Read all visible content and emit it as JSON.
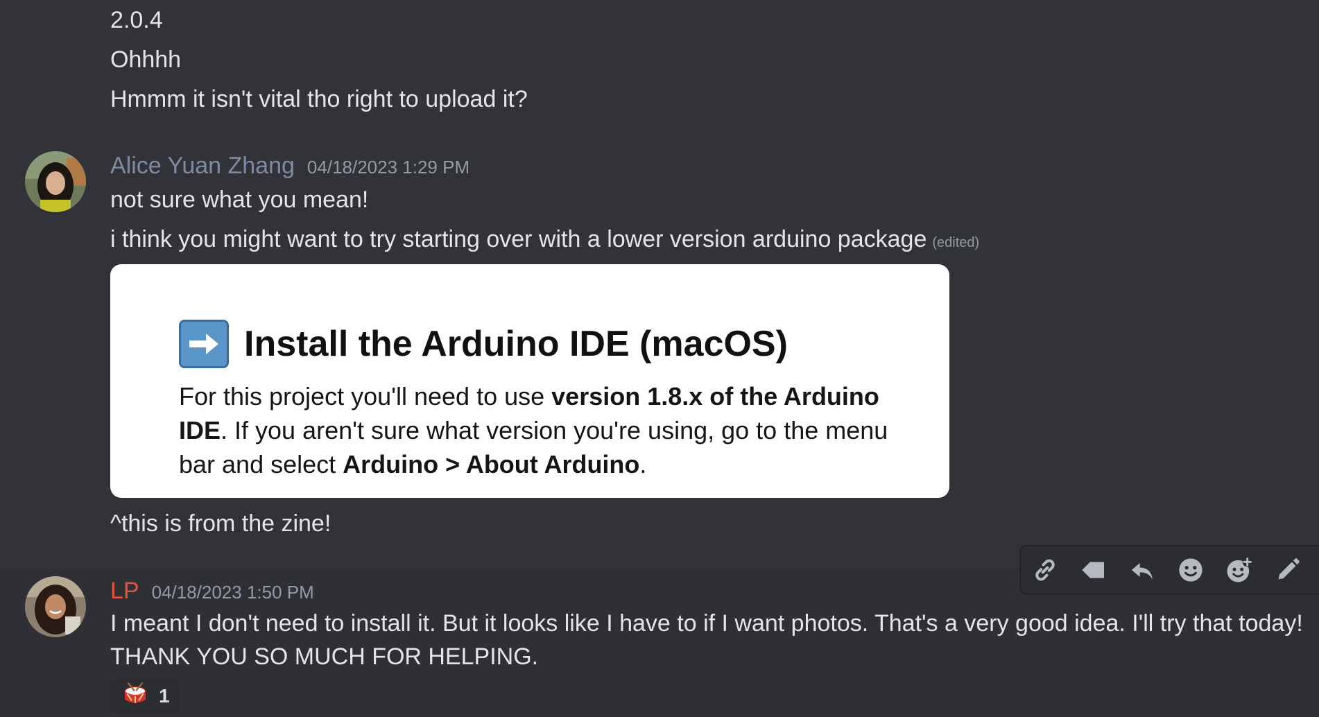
{
  "messages_prev": [
    {
      "text": "2.0.4"
    },
    {
      "text": "Ohhhh"
    },
    {
      "text": "Hmmm it isn't vital tho right to upload it?"
    }
  ],
  "alice": {
    "username": "Alice Yuan Zhang",
    "timestamp": "04/18/2023 1:29 PM",
    "name_color": "#7d8ca3",
    "lines": [
      "not sure what you mean!",
      "i think you might want to try starting over with a lower version arduino package"
    ],
    "edited_label": "(edited)",
    "embed": {
      "title": "Install the Arduino IDE (macOS)",
      "body_part1": "For this project you'll need to use ",
      "body_bold1": "version 1.8.x of the Arduino IDE",
      "body_part2": ". If you aren't sure what version you're using, go to the menu bar and select ",
      "body_bold2": "Arduino > About Arduino",
      "body_part3": "."
    },
    "after_embed": "^this is from the zine!"
  },
  "lp": {
    "username": "LP",
    "timestamp": "04/18/2023 1:50 PM",
    "name_color": "#e0533d",
    "lines": [
      "I meant I don't need to install it. But it looks like I have to if I want photos. That's a very good idea. I'll try that today!",
      "THANK YOU SO MUCH FOR HELPING."
    ],
    "reaction": {
      "icon": "drum-emoji",
      "count": "1"
    }
  },
  "toolbar_icons": [
    "link-icon",
    "tag-icon",
    "reply-icon",
    "emoji-icon",
    "add-reaction-icon",
    "edit-icon"
  ]
}
